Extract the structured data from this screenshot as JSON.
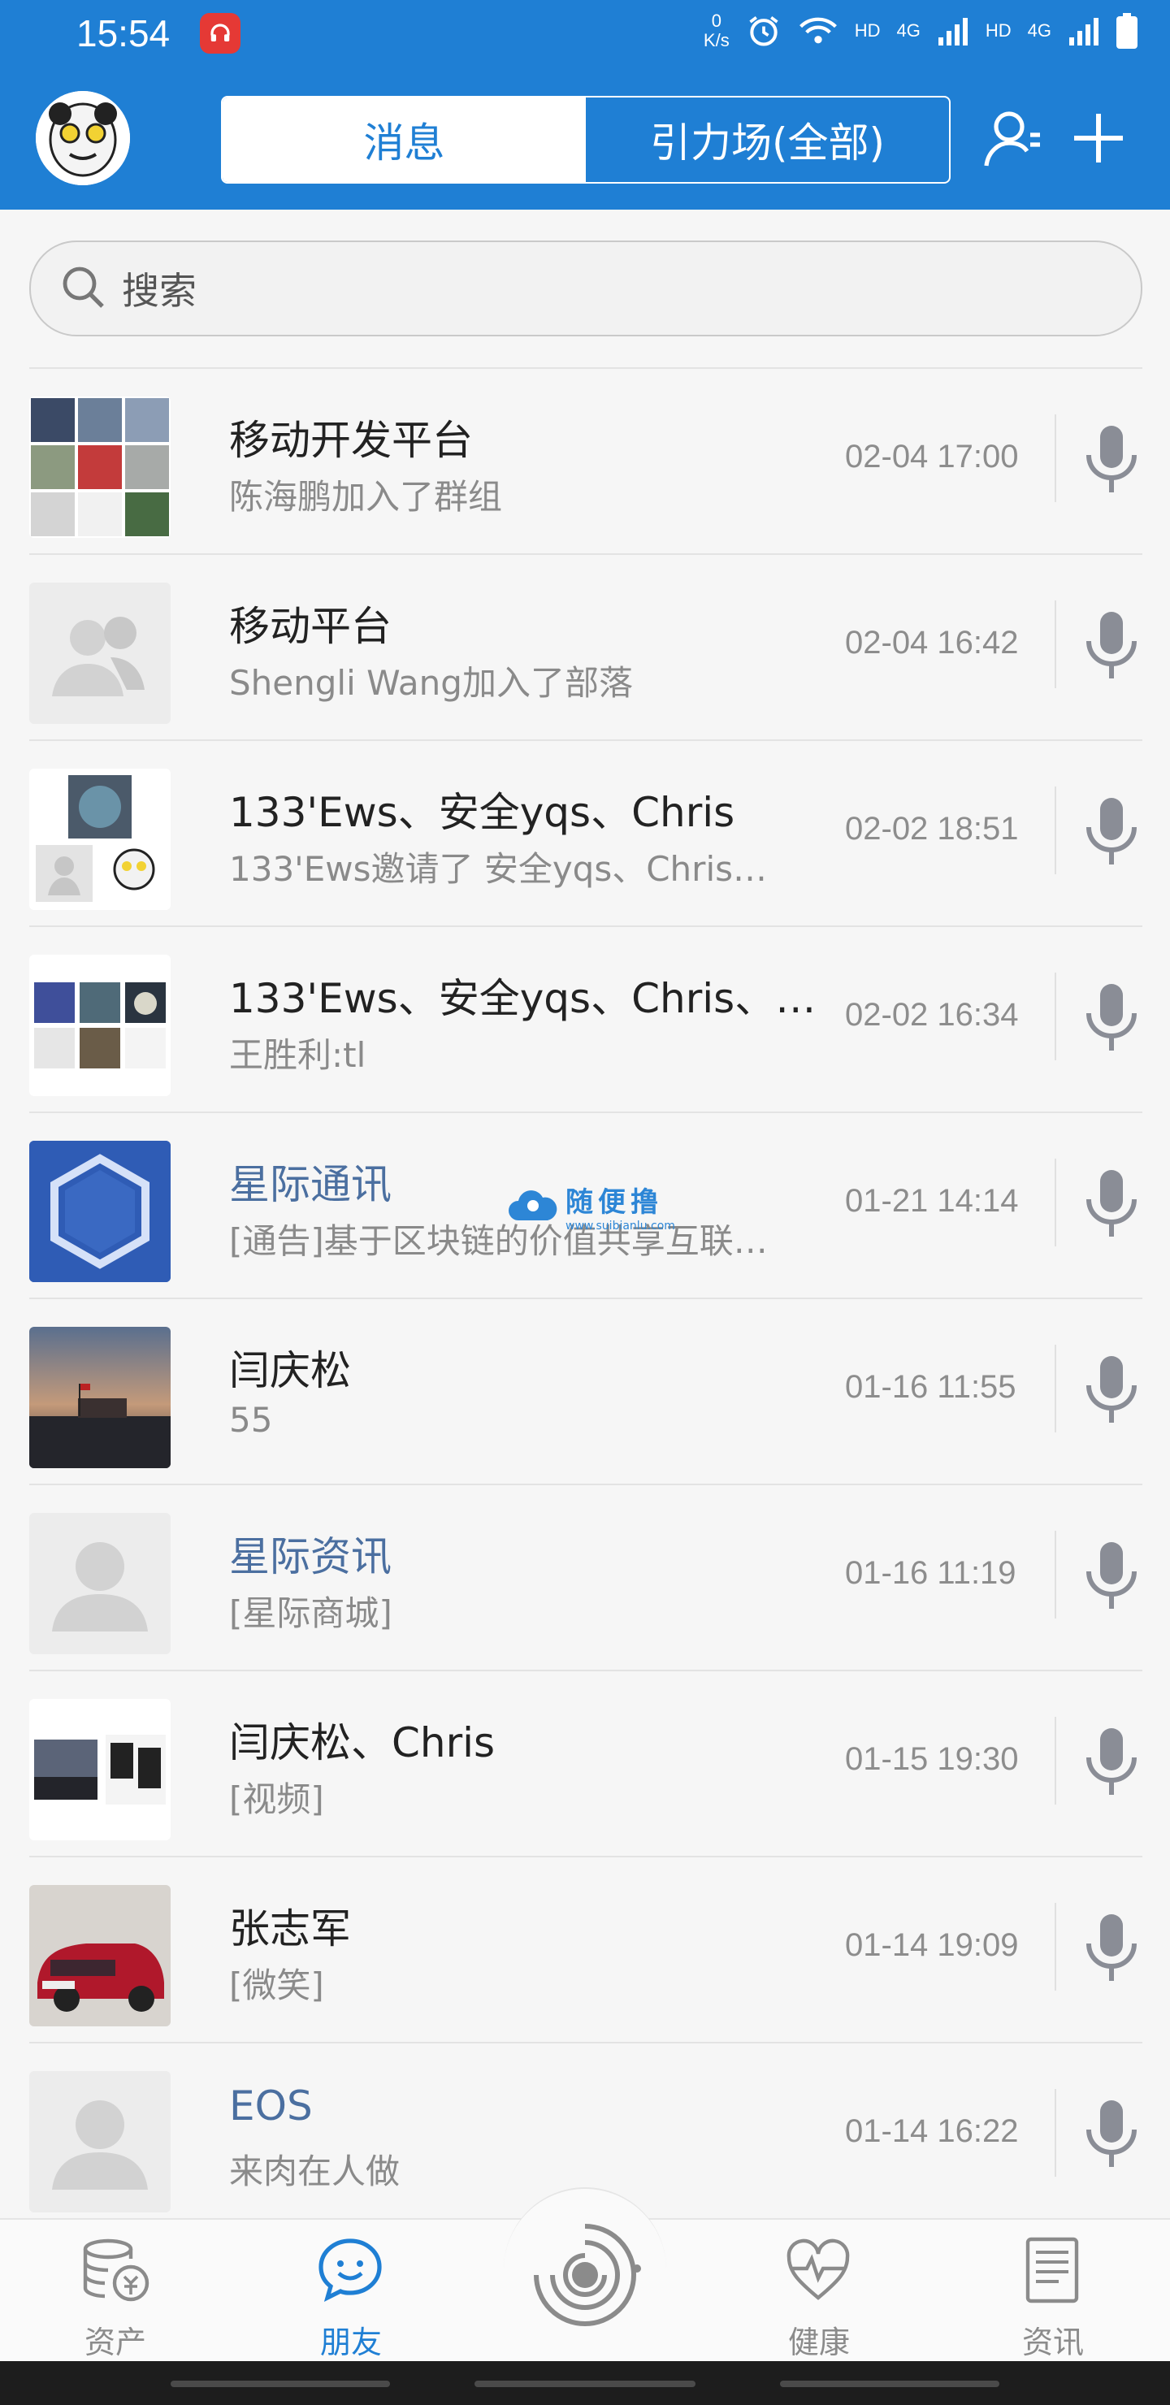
{
  "status_bar": {
    "time": "15:54",
    "net_speed_top": "0",
    "net_speed_bottom": "K/s",
    "hd1": "HD",
    "g1": "4G",
    "hd2": "HD",
    "g2": "4G"
  },
  "header": {
    "tabs": [
      {
        "label": "消息",
        "active": true
      },
      {
        "label": "引力场(全部)",
        "active": false
      }
    ],
    "icons": [
      "contacts-icon",
      "plus-icon"
    ],
    "brand_color": "#1f7fd4"
  },
  "search": {
    "placeholder": "搜索"
  },
  "conversations": [
    {
      "title": "移动开发平台",
      "subtitle": "陈海鹏加入了群组",
      "time": "02-04 17:00",
      "official": false
    },
    {
      "title": "移动平台",
      "subtitle": "Shengli Wang加入了部落",
      "time": "02-04 16:42",
      "official": false
    },
    {
      "title": "133'Ews、安全yqs、Chris",
      "subtitle": "133'Ews邀请了 安全yqs、Chris…",
      "time": "02-02 18:51",
      "official": false
    },
    {
      "title": "133'Ews、安全yqs、Chris、…",
      "subtitle": "王胜利:tl",
      "time": "02-02 16:34",
      "official": false
    },
    {
      "title": "星际通讯",
      "subtitle": "[通告]基于区块链的价值共享互联…",
      "time": "01-21 14:14",
      "official": true
    },
    {
      "title": "闫庆松",
      "subtitle": "55",
      "time": "01-16 11:55",
      "official": false
    },
    {
      "title": "星际资讯",
      "subtitle": "[星际商城]",
      "time": "01-16 11:19",
      "official": true
    },
    {
      "title": "闫庆松、Chris",
      "subtitle": "[视频]",
      "time": "01-15 19:30",
      "official": false
    },
    {
      "title": "张志军",
      "subtitle": "[微笑]",
      "time": "01-14 19:09",
      "official": false
    },
    {
      "title": "EOS",
      "subtitle": "来肉在人做",
      "time": "01-14 16:22",
      "official": true
    }
  ],
  "watermark": {
    "text": "随便撸",
    "url": "www.suibianlu.com"
  },
  "bottom_nav": [
    {
      "label": "资产",
      "icon": "coins-icon",
      "active": false
    },
    {
      "label": "朋友",
      "icon": "chat-icon",
      "active": true
    },
    {
      "label": "",
      "icon": "galaxy-icon",
      "active": false
    },
    {
      "label": "健康",
      "icon": "heart-pulse-icon",
      "active": false
    },
    {
      "label": "资讯",
      "icon": "news-icon",
      "active": false
    }
  ]
}
